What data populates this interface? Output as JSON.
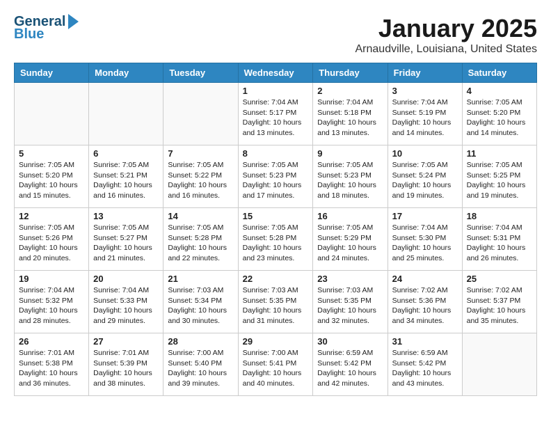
{
  "logo": {
    "line1": "General",
    "line2": "Blue"
  },
  "title": "January 2025",
  "location": "Arnaudville, Louisiana, United States",
  "days_of_week": [
    "Sunday",
    "Monday",
    "Tuesday",
    "Wednesday",
    "Thursday",
    "Friday",
    "Saturday"
  ],
  "weeks": [
    [
      {
        "day": "",
        "info": ""
      },
      {
        "day": "",
        "info": ""
      },
      {
        "day": "",
        "info": ""
      },
      {
        "day": "1",
        "info": "Sunrise: 7:04 AM\nSunset: 5:17 PM\nDaylight: 10 hours\nand 13 minutes."
      },
      {
        "day": "2",
        "info": "Sunrise: 7:04 AM\nSunset: 5:18 PM\nDaylight: 10 hours\nand 13 minutes."
      },
      {
        "day": "3",
        "info": "Sunrise: 7:04 AM\nSunset: 5:19 PM\nDaylight: 10 hours\nand 14 minutes."
      },
      {
        "day": "4",
        "info": "Sunrise: 7:05 AM\nSunset: 5:20 PM\nDaylight: 10 hours\nand 14 minutes."
      }
    ],
    [
      {
        "day": "5",
        "info": "Sunrise: 7:05 AM\nSunset: 5:20 PM\nDaylight: 10 hours\nand 15 minutes."
      },
      {
        "day": "6",
        "info": "Sunrise: 7:05 AM\nSunset: 5:21 PM\nDaylight: 10 hours\nand 16 minutes."
      },
      {
        "day": "7",
        "info": "Sunrise: 7:05 AM\nSunset: 5:22 PM\nDaylight: 10 hours\nand 16 minutes."
      },
      {
        "day": "8",
        "info": "Sunrise: 7:05 AM\nSunset: 5:23 PM\nDaylight: 10 hours\nand 17 minutes."
      },
      {
        "day": "9",
        "info": "Sunrise: 7:05 AM\nSunset: 5:23 PM\nDaylight: 10 hours\nand 18 minutes."
      },
      {
        "day": "10",
        "info": "Sunrise: 7:05 AM\nSunset: 5:24 PM\nDaylight: 10 hours\nand 19 minutes."
      },
      {
        "day": "11",
        "info": "Sunrise: 7:05 AM\nSunset: 5:25 PM\nDaylight: 10 hours\nand 19 minutes."
      }
    ],
    [
      {
        "day": "12",
        "info": "Sunrise: 7:05 AM\nSunset: 5:26 PM\nDaylight: 10 hours\nand 20 minutes."
      },
      {
        "day": "13",
        "info": "Sunrise: 7:05 AM\nSunset: 5:27 PM\nDaylight: 10 hours\nand 21 minutes."
      },
      {
        "day": "14",
        "info": "Sunrise: 7:05 AM\nSunset: 5:28 PM\nDaylight: 10 hours\nand 22 minutes."
      },
      {
        "day": "15",
        "info": "Sunrise: 7:05 AM\nSunset: 5:28 PM\nDaylight: 10 hours\nand 23 minutes."
      },
      {
        "day": "16",
        "info": "Sunrise: 7:05 AM\nSunset: 5:29 PM\nDaylight: 10 hours\nand 24 minutes."
      },
      {
        "day": "17",
        "info": "Sunrise: 7:04 AM\nSunset: 5:30 PM\nDaylight: 10 hours\nand 25 minutes."
      },
      {
        "day": "18",
        "info": "Sunrise: 7:04 AM\nSunset: 5:31 PM\nDaylight: 10 hours\nand 26 minutes."
      }
    ],
    [
      {
        "day": "19",
        "info": "Sunrise: 7:04 AM\nSunset: 5:32 PM\nDaylight: 10 hours\nand 28 minutes."
      },
      {
        "day": "20",
        "info": "Sunrise: 7:04 AM\nSunset: 5:33 PM\nDaylight: 10 hours\nand 29 minutes."
      },
      {
        "day": "21",
        "info": "Sunrise: 7:03 AM\nSunset: 5:34 PM\nDaylight: 10 hours\nand 30 minutes."
      },
      {
        "day": "22",
        "info": "Sunrise: 7:03 AM\nSunset: 5:35 PM\nDaylight: 10 hours\nand 31 minutes."
      },
      {
        "day": "23",
        "info": "Sunrise: 7:03 AM\nSunset: 5:35 PM\nDaylight: 10 hours\nand 32 minutes."
      },
      {
        "day": "24",
        "info": "Sunrise: 7:02 AM\nSunset: 5:36 PM\nDaylight: 10 hours\nand 34 minutes."
      },
      {
        "day": "25",
        "info": "Sunrise: 7:02 AM\nSunset: 5:37 PM\nDaylight: 10 hours\nand 35 minutes."
      }
    ],
    [
      {
        "day": "26",
        "info": "Sunrise: 7:01 AM\nSunset: 5:38 PM\nDaylight: 10 hours\nand 36 minutes."
      },
      {
        "day": "27",
        "info": "Sunrise: 7:01 AM\nSunset: 5:39 PM\nDaylight: 10 hours\nand 38 minutes."
      },
      {
        "day": "28",
        "info": "Sunrise: 7:00 AM\nSunset: 5:40 PM\nDaylight: 10 hours\nand 39 minutes."
      },
      {
        "day": "29",
        "info": "Sunrise: 7:00 AM\nSunset: 5:41 PM\nDaylight: 10 hours\nand 40 minutes."
      },
      {
        "day": "30",
        "info": "Sunrise: 6:59 AM\nSunset: 5:42 PM\nDaylight: 10 hours\nand 42 minutes."
      },
      {
        "day": "31",
        "info": "Sunrise: 6:59 AM\nSunset: 5:42 PM\nDaylight: 10 hours\nand 43 minutes."
      },
      {
        "day": "",
        "info": ""
      }
    ]
  ]
}
